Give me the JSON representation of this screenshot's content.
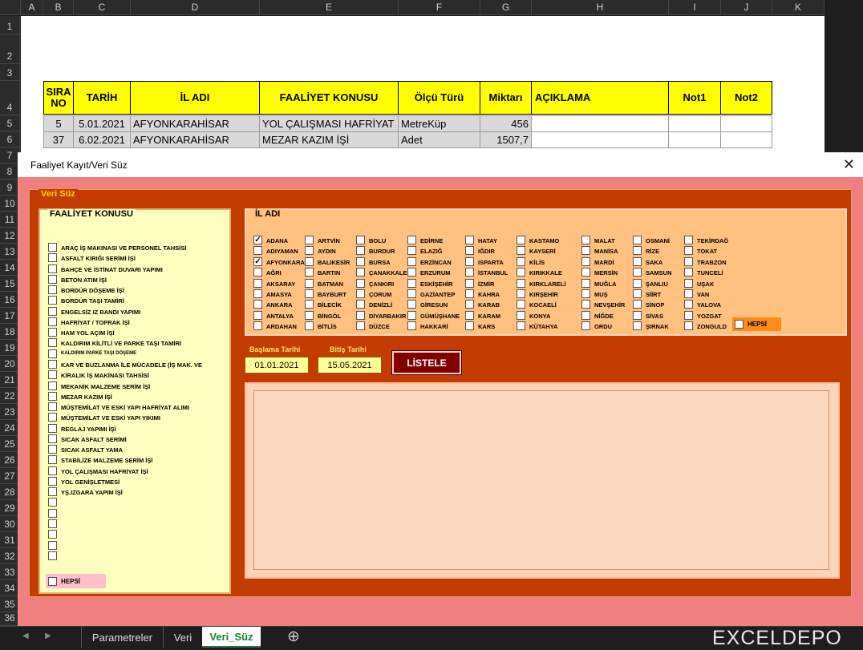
{
  "columns": [
    "A",
    "B",
    "C",
    "D",
    "E",
    "F",
    "G",
    "H",
    "I",
    "J",
    "K"
  ],
  "rows": [
    "1",
    "2",
    "3",
    "4",
    "5",
    "6",
    "7",
    "8",
    "9",
    "10",
    "11",
    "12",
    "13",
    "14",
    "15",
    "16",
    "17",
    "18",
    "19",
    "20",
    "21",
    "22",
    "23",
    "24",
    "25",
    "26",
    "27",
    "28",
    "29",
    "30",
    "31",
    "32",
    "33",
    "34",
    "35",
    "36"
  ],
  "table": {
    "headers": [
      "SIRA\nNO",
      "TARİH",
      "İL ADI",
      "FAALİYET KONUSU",
      "Ölçü Türü",
      "Miktarı",
      "AÇIKLAMA",
      "Not1",
      "Not2"
    ],
    "rows": [
      [
        "5",
        "5.01.2021",
        "AFYONKARAHİSAR",
        "YOL ÇALIŞMASI HAFRİYAT İŞ",
        "MetreKüp",
        "456",
        "",
        "",
        ""
      ],
      [
        "37",
        "6.02.2021",
        "AFYONKARAHİSAR",
        "MEZAR KAZIM İŞİ",
        "Adet",
        "1507,7",
        "",
        "",
        ""
      ]
    ]
  },
  "form": {
    "title": "Faaliyet Kayıt/Veri Süz",
    "close": "✕",
    "frame_label": "Veri Süz",
    "faaliyet": {
      "title": "FAALİYET KONUSU",
      "items": [
        "ARAÇ İŞ MAKINASI VE PERSONEL TAHSİSİ",
        "ASFALT KIRIĞI SERİMİ İŞİ",
        "BAHÇE VE İSTİNAT DUVARI YAPIMI",
        "BETON ATIM İŞİ",
        "BORDÜR DÖŞEME İŞİ",
        "BORDÜR TAŞI TAMİRİ",
        "ENGELSİZ IZ BANDI YAPIMI",
        "HAFRİYAT / TOPRAK İŞİ",
        "HAM YOL AÇIM İŞİ",
        "KALDIRIM KİLİTLİ VE PARKE TAŞI TAMİRİ",
        "KALDIRIM PARKE TAŞI DÖŞEME",
        "KAR VE BUZLANMA İLE MÜCADELE  (İŞ MAK. VE",
        "KİRALIK İŞ MAKİNASI TAHSİSİ",
        "MEKANİK MALZEME SERİM İŞİ",
        "MEZAR KAZIM İŞİ",
        "MÜŞTEMİLAT VE ESKİ YAPI HAFRİYAT ALIMI",
        "MÜŞTEMİLAT VE ESKİ YAPI YIKIMI",
        "REGLAJ YAPIMI İŞİ",
        "SICAK ASFALT SERİMİ",
        "SICAK ASFALT YAMA",
        "STABİLİZE MALZEME SERİM İŞİ",
        "YOL ÇALIŞMASI HAFRİYAT İŞİ",
        "YOL GENİŞLETMESİ",
        "YŞ.IZGARA YAPIM İŞİ",
        "",
        "",
        "",
        "",
        "",
        ""
      ],
      "hepsi": "HEPSİ"
    },
    "il": {
      "title": "İL ADI",
      "columns": [
        [
          "ADANA",
          "ADIYAMAN",
          "AFYONKARAHİSAR",
          "AĞRI",
          "AKSARAY",
          "AMASYA",
          "ANKARA",
          "ANTALYA",
          "ARDAHAN"
        ],
        [
          "ARTVİN",
          "AYDIN",
          "BALIKESİR",
          "BARTIN",
          "BATMAN",
          "BAYBURT",
          "BİLECİK",
          "BİNGÖL",
          "BİTLİS"
        ],
        [
          "BOLU",
          "BURDUR",
          "BURSA",
          "ÇANAKKALE",
          "ÇANKIRI",
          "ÇORUM",
          "DENİZLİ",
          "DİYARBAKIR",
          "DÜZCE"
        ],
        [
          "EDİRNE",
          "ELAZIĞ",
          "ERZİNCAN",
          "ERZURUM",
          "ESKİŞEHİR",
          "GAZİANTEP",
          "GİRESUN",
          "GÜMÜŞHANE",
          "HAKKARİ"
        ],
        [
          "HATAY",
          "IĞDIR",
          "ISPARTA",
          "İSTANBUL",
          "İZMİR",
          "KAHRA",
          "KARAB",
          "KARAM",
          "KARS"
        ],
        [
          "KASTAMO",
          "KAYSERİ",
          "KİLİS",
          "KIRIKKALE",
          "KIRKLARELİ",
          "KIRŞEHİR",
          "KOCAELİ",
          "KONYA",
          "KÜTAHYA"
        ],
        [
          "MALAT",
          "MANİSA",
          "MARDİ",
          "MERSİN",
          "MUĞLA",
          "MUŞ",
          "NEVŞEHİR",
          "NİĞDE",
          "ORDU"
        ],
        [
          "OSMANİ",
          "RİZE",
          "SAKA",
          "SAMSUN",
          "ŞANLIU",
          "SİİRT",
          "SİNOP",
          "SİVAS",
          "ŞIRNAK"
        ],
        [
          "TEKİRDAĞ",
          "TOKAT",
          "TRABZON",
          "TUNCELİ",
          "UŞAK",
          "VAN",
          "YALOVA",
          "YOZGAT",
          "ZONGULD"
        ]
      ],
      "checked": [
        "ADANA",
        "AFYONKARAHİSAR"
      ],
      "hepsi": "HEPSİ"
    },
    "start_label": "Başlama Tarihi",
    "end_label": "Bitiş Tarihi",
    "start_date": "01.01.2021",
    "end_date": "15.05.2021",
    "list_button": "LİSTELE"
  },
  "tabs": {
    "items": [
      "Parametreler",
      "Veri",
      "Veri_Süz"
    ],
    "active": "Veri_Süz",
    "add": "⊕"
  },
  "logo_text": "EXCELDEPO"
}
